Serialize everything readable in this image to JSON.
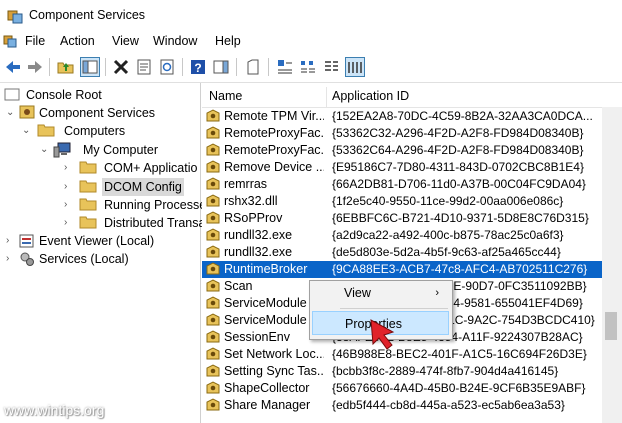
{
  "window": {
    "title": "Component Services"
  },
  "menu": [
    "File",
    "Action",
    "View",
    "Window",
    "Help"
  ],
  "tree": [
    {
      "label": "Console Root",
      "expander": "",
      "icon": "folder-icon"
    },
    {
      "label": "Component Services",
      "expander": "v",
      "icon": "component-services-icon"
    },
    {
      "label": "Computers",
      "expander": "v",
      "icon": "folder-icon"
    },
    {
      "label": "My Computer",
      "expander": "v",
      "icon": "computer-icon"
    },
    {
      "label": "COM+ Applicatio",
      "expander": ">",
      "icon": "folder-icon"
    },
    {
      "label": "DCOM Config",
      "expander": ">",
      "icon": "folder-icon"
    },
    {
      "label": "Running Processe",
      "expander": ">",
      "icon": "folder-icon"
    },
    {
      "label": "Distributed Transa",
      "expander": ">",
      "icon": "folder-icon"
    },
    {
      "label": "Event Viewer (Local)",
      "expander": ">",
      "icon": "event-viewer-icon"
    },
    {
      "label": "Services (Local)",
      "expander": ">",
      "icon": "services-icon"
    }
  ],
  "list": {
    "columns": [
      "Name",
      "Application ID"
    ],
    "rows": [
      {
        "name": "Remote TPM Vir...",
        "id": "{152EA2A8-70DC-4C59-8B2A-32AA3CA0DCA..."
      },
      {
        "name": "RemoteProxyFac...",
        "id": "{53362C32-A296-4F2D-A2F8-FD984D08340B}"
      },
      {
        "name": "RemoteProxyFac...",
        "id": "{53362C64-A296-4F2D-A2F8-FD984D08340B}"
      },
      {
        "name": "Remove Device ...",
        "id": "{E95186C7-7D80-4311-843D-0702CBC8B1E4}"
      },
      {
        "name": "remrras",
        "id": "{66A2DB81-D706-11d0-A37B-00C04FC9DA04}"
      },
      {
        "name": "rshx32.dll",
        "id": "{1f2e5c40-9550-11ce-99d2-00aa006e086c}"
      },
      {
        "name": "RSoPProv",
        "id": "{6EBBFC6C-B721-4D10-9371-5D8E8C76D315}"
      },
      {
        "name": "rundll32.exe",
        "id": "{a2d9ca22-a492-400c-b875-78ac25c0a6f3}"
      },
      {
        "name": "rundll32.exe",
        "id": "{de5d803e-5d2a-4b5f-9c63-af25a465cc44}"
      },
      {
        "name": "RuntimeBroker",
        "id": "{9CA88EE3-ACB7-47c8-AFC4-AB702511C276}"
      },
      {
        "name": "Scan",
        "id": "{6C57C5F5-1B2B-4BFE-90D7-0FC3511092BB}"
      },
      {
        "name": "ServiceModule",
        "id": "{F0C3F6A7-5AE0-45D4-9581-655041EF4D69}"
      },
      {
        "name": "ServiceModule",
        "id": "{B8E9D5C7-3E2A-4B1C-9A2C-754D3BCDC410}"
      },
      {
        "name": "SessionEnv",
        "id": "{38AFE3E2-B8E5-4354-A11F-9224307B28AC}"
      },
      {
        "name": "Set Network Loc...",
        "id": "{46B988E8-BEC2-401F-A1C5-16C694F26D3E}"
      },
      {
        "name": "Setting Sync Tas...",
        "id": "{bcbb3f8c-2889-474f-8fb7-904d4a416145}"
      },
      {
        "name": "ShapeCollector",
        "id": "{56676660-4A4D-45B0-B24E-9CF6B35E9ABF}"
      },
      {
        "name": "Share Manager",
        "id": "{edb5f444-cb8d-445a-a523-ec5ab6ea3a53}"
      }
    ],
    "selected_index": 9
  },
  "context_menu": {
    "items": [
      "View",
      "Properties"
    ],
    "highlighted": "Properties"
  },
  "watermark": "www.wintips.org",
  "colors": {
    "selection": "#0a64c8",
    "folder": "#e8c35a",
    "highlight": "#cce8ff",
    "arrow": "#e0222a"
  }
}
